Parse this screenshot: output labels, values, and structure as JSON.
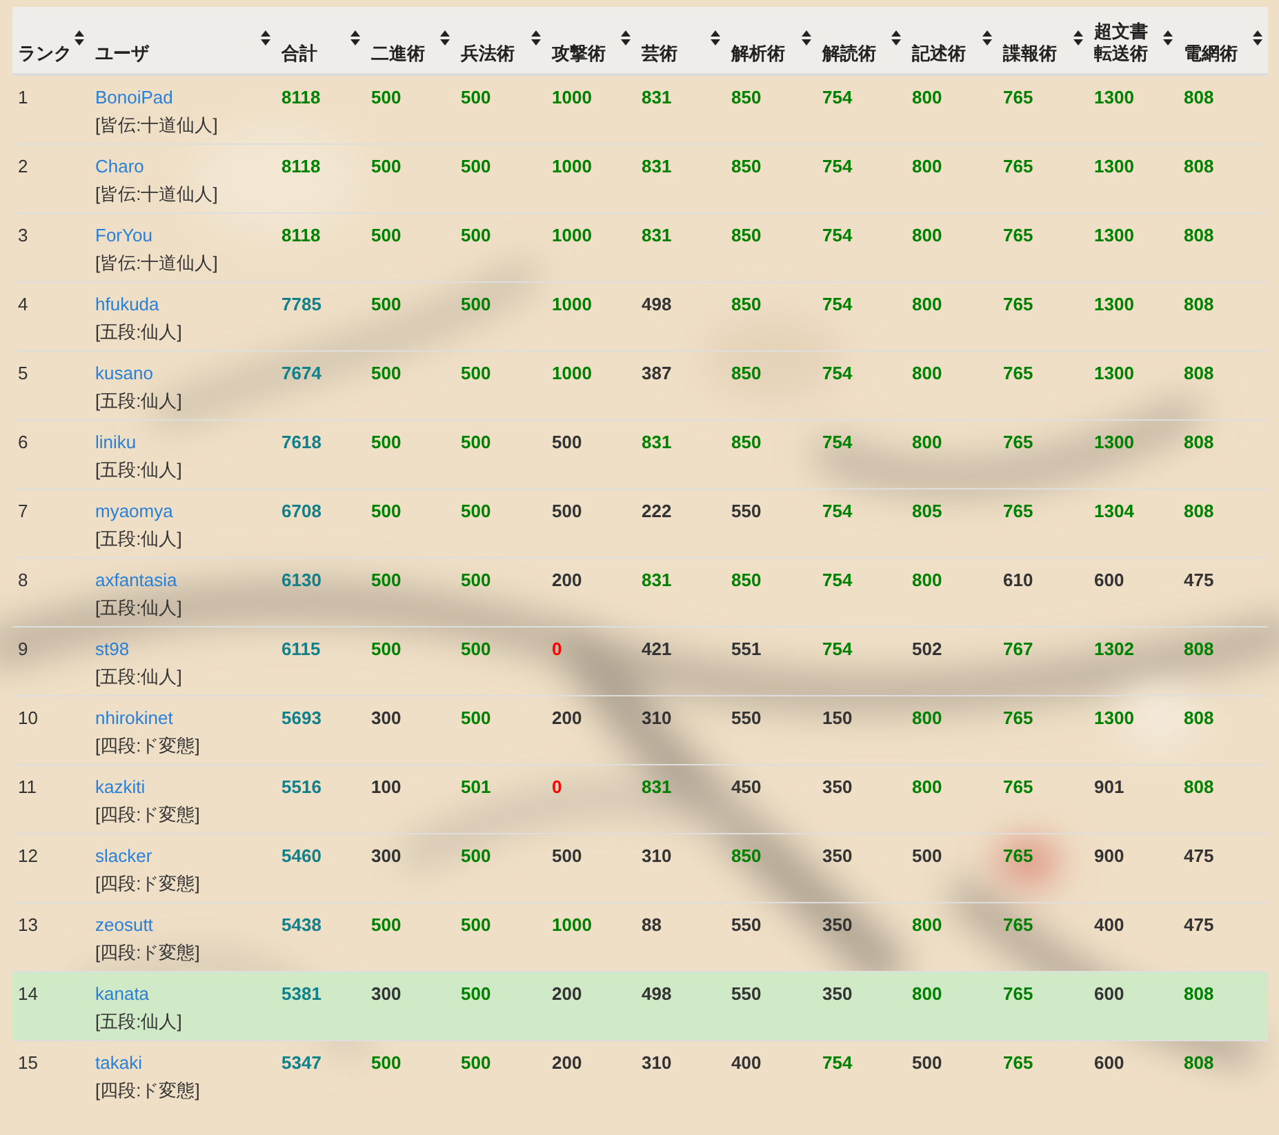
{
  "columns": [
    {
      "label": "ランク"
    },
    {
      "label": "ユーザ"
    },
    {
      "label": "合計"
    },
    {
      "label": "二進術"
    },
    {
      "label": "兵法術"
    },
    {
      "label": "攻撃術"
    },
    {
      "label": "芸術"
    },
    {
      "label": "解析術"
    },
    {
      "label": "解読術"
    },
    {
      "label": "記述術"
    },
    {
      "label": "諜報術"
    },
    {
      "label": "超文書転送術"
    },
    {
      "label": "電網術"
    }
  ],
  "rows": [
    {
      "rank": "1",
      "user": "BonoiPad",
      "title": "[皆伝:十道仙人]",
      "highlighted": false,
      "total": {
        "v": "8118",
        "color": "#008000"
      },
      "scores": [
        {
          "v": "500",
          "color": "#008000"
        },
        {
          "v": "500",
          "color": "#008000"
        },
        {
          "v": "1000",
          "color": "#008000"
        },
        {
          "v": "831",
          "color": "#008000"
        },
        {
          "v": "850",
          "color": "#008000"
        },
        {
          "v": "754",
          "color": "#008000"
        },
        {
          "v": "800",
          "color": "#008000"
        },
        {
          "v": "765",
          "color": "#008000"
        },
        {
          "v": "1300",
          "color": "#008000"
        },
        {
          "v": "808",
          "color": "#008000"
        }
      ]
    },
    {
      "rank": "2",
      "user": "Charo",
      "title": "[皆伝:十道仙人]",
      "highlighted": false,
      "total": {
        "v": "8118",
        "color": "#008000"
      },
      "scores": [
        {
          "v": "500",
          "color": "#008000"
        },
        {
          "v": "500",
          "color": "#008000"
        },
        {
          "v": "1000",
          "color": "#008000"
        },
        {
          "v": "831",
          "color": "#008000"
        },
        {
          "v": "850",
          "color": "#008000"
        },
        {
          "v": "754",
          "color": "#008000"
        },
        {
          "v": "800",
          "color": "#008000"
        },
        {
          "v": "765",
          "color": "#008000"
        },
        {
          "v": "1300",
          "color": "#008000"
        },
        {
          "v": "808",
          "color": "#008000"
        }
      ]
    },
    {
      "rank": "3",
      "user": "ForYou",
      "title": "[皆伝:十道仙人]",
      "highlighted": false,
      "total": {
        "v": "8118",
        "color": "#008000"
      },
      "scores": [
        {
          "v": "500",
          "color": "#008000"
        },
        {
          "v": "500",
          "color": "#008000"
        },
        {
          "v": "1000",
          "color": "#008000"
        },
        {
          "v": "831",
          "color": "#008000"
        },
        {
          "v": "850",
          "color": "#008000"
        },
        {
          "v": "754",
          "color": "#008000"
        },
        {
          "v": "800",
          "color": "#008000"
        },
        {
          "v": "765",
          "color": "#008000"
        },
        {
          "v": "1300",
          "color": "#008000"
        },
        {
          "v": "808",
          "color": "#008000"
        }
      ]
    },
    {
      "rank": "4",
      "user": "hfukuda",
      "title": "[五段:仙人]",
      "highlighted": false,
      "total": {
        "v": "7785",
        "color": "#11808a"
      },
      "scores": [
        {
          "v": "500",
          "color": "#008000"
        },
        {
          "v": "500",
          "color": "#008000"
        },
        {
          "v": "1000",
          "color": "#008000"
        },
        {
          "v": "498",
          "color": "#333333"
        },
        {
          "v": "850",
          "color": "#008000"
        },
        {
          "v": "754",
          "color": "#008000"
        },
        {
          "v": "800",
          "color": "#008000"
        },
        {
          "v": "765",
          "color": "#008000"
        },
        {
          "v": "1300",
          "color": "#008000"
        },
        {
          "v": "808",
          "color": "#008000"
        }
      ]
    },
    {
      "rank": "5",
      "user": "kusano",
      "title": "[五段:仙人]",
      "highlighted": false,
      "total": {
        "v": "7674",
        "color": "#11808a"
      },
      "scores": [
        {
          "v": "500",
          "color": "#008000"
        },
        {
          "v": "500",
          "color": "#008000"
        },
        {
          "v": "1000",
          "color": "#008000"
        },
        {
          "v": "387",
          "color": "#333333"
        },
        {
          "v": "850",
          "color": "#008000"
        },
        {
          "v": "754",
          "color": "#008000"
        },
        {
          "v": "800",
          "color": "#008000"
        },
        {
          "v": "765",
          "color": "#008000"
        },
        {
          "v": "1300",
          "color": "#008000"
        },
        {
          "v": "808",
          "color": "#008000"
        }
      ]
    },
    {
      "rank": "6",
      "user": "liniku",
      "title": "[五段:仙人]",
      "highlighted": false,
      "total": {
        "v": "7618",
        "color": "#11808a"
      },
      "scores": [
        {
          "v": "500",
          "color": "#008000"
        },
        {
          "v": "500",
          "color": "#008000"
        },
        {
          "v": "500",
          "color": "#333333"
        },
        {
          "v": "831",
          "color": "#008000"
        },
        {
          "v": "850",
          "color": "#008000"
        },
        {
          "v": "754",
          "color": "#008000"
        },
        {
          "v": "800",
          "color": "#008000"
        },
        {
          "v": "765",
          "color": "#008000"
        },
        {
          "v": "1300",
          "color": "#008000"
        },
        {
          "v": "808",
          "color": "#008000"
        }
      ]
    },
    {
      "rank": "7",
      "user": "myaomya",
      "title": "[五段:仙人]",
      "highlighted": false,
      "total": {
        "v": "6708",
        "color": "#11808a"
      },
      "scores": [
        {
          "v": "500",
          "color": "#008000"
        },
        {
          "v": "500",
          "color": "#008000"
        },
        {
          "v": "500",
          "color": "#333333"
        },
        {
          "v": "222",
          "color": "#333333"
        },
        {
          "v": "550",
          "color": "#333333"
        },
        {
          "v": "754",
          "color": "#008000"
        },
        {
          "v": "805",
          "color": "#008000"
        },
        {
          "v": "765",
          "color": "#008000"
        },
        {
          "v": "1304",
          "color": "#008000"
        },
        {
          "v": "808",
          "color": "#008000"
        }
      ]
    },
    {
      "rank": "8",
      "user": "axfantasia",
      "title": "[五段:仙人]",
      "highlighted": false,
      "total": {
        "v": "6130",
        "color": "#11808a"
      },
      "scores": [
        {
          "v": "500",
          "color": "#008000"
        },
        {
          "v": "500",
          "color": "#008000"
        },
        {
          "v": "200",
          "color": "#333333"
        },
        {
          "v": "831",
          "color": "#008000"
        },
        {
          "v": "850",
          "color": "#008000"
        },
        {
          "v": "754",
          "color": "#008000"
        },
        {
          "v": "800",
          "color": "#008000"
        },
        {
          "v": "610",
          "color": "#333333"
        },
        {
          "v": "600",
          "color": "#333333"
        },
        {
          "v": "475",
          "color": "#333333"
        }
      ]
    },
    {
      "rank": "9",
      "user": "st98",
      "title": "[五段:仙人]",
      "highlighted": false,
      "total": {
        "v": "6115",
        "color": "#11808a"
      },
      "scores": [
        {
          "v": "500",
          "color": "#008000"
        },
        {
          "v": "500",
          "color": "#008000"
        },
        {
          "v": "0",
          "color": "#ff0000"
        },
        {
          "v": "421",
          "color": "#333333"
        },
        {
          "v": "551",
          "color": "#333333"
        },
        {
          "v": "754",
          "color": "#008000"
        },
        {
          "v": "502",
          "color": "#333333"
        },
        {
          "v": "767",
          "color": "#008000"
        },
        {
          "v": "1302",
          "color": "#008000"
        },
        {
          "v": "808",
          "color": "#008000"
        }
      ]
    },
    {
      "rank": "10",
      "user": "nhirokinet",
      "title": "[四段:ド変態]",
      "highlighted": false,
      "total": {
        "v": "5693",
        "color": "#11808a"
      },
      "scores": [
        {
          "v": "300",
          "color": "#333333"
        },
        {
          "v": "500",
          "color": "#008000"
        },
        {
          "v": "200",
          "color": "#333333"
        },
        {
          "v": "310",
          "color": "#333333"
        },
        {
          "v": "550",
          "color": "#333333"
        },
        {
          "v": "150",
          "color": "#333333"
        },
        {
          "v": "800",
          "color": "#008000"
        },
        {
          "v": "765",
          "color": "#008000"
        },
        {
          "v": "1300",
          "color": "#008000"
        },
        {
          "v": "808",
          "color": "#008000"
        }
      ]
    },
    {
      "rank": "11",
      "user": "kazkiti",
      "title": "[四段:ド変態]",
      "highlighted": false,
      "total": {
        "v": "5516",
        "color": "#11808a"
      },
      "scores": [
        {
          "v": "100",
          "color": "#333333"
        },
        {
          "v": "501",
          "color": "#008000"
        },
        {
          "v": "0",
          "color": "#ff0000"
        },
        {
          "v": "831",
          "color": "#008000"
        },
        {
          "v": "450",
          "color": "#333333"
        },
        {
          "v": "350",
          "color": "#333333"
        },
        {
          "v": "800",
          "color": "#008000"
        },
        {
          "v": "765",
          "color": "#008000"
        },
        {
          "v": "901",
          "color": "#333333"
        },
        {
          "v": "808",
          "color": "#008000"
        }
      ]
    },
    {
      "rank": "12",
      "user": "slacker",
      "title": "[四段:ド変態]",
      "highlighted": false,
      "total": {
        "v": "5460",
        "color": "#11808a"
      },
      "scores": [
        {
          "v": "300",
          "color": "#333333"
        },
        {
          "v": "500",
          "color": "#008000"
        },
        {
          "v": "500",
          "color": "#333333"
        },
        {
          "v": "310",
          "color": "#333333"
        },
        {
          "v": "850",
          "color": "#008000"
        },
        {
          "v": "350",
          "color": "#333333"
        },
        {
          "v": "500",
          "color": "#333333"
        },
        {
          "v": "765",
          "color": "#008000"
        },
        {
          "v": "900",
          "color": "#333333"
        },
        {
          "v": "475",
          "color": "#333333"
        }
      ]
    },
    {
      "rank": "13",
      "user": "zeosutt",
      "title": "[四段:ド変態]",
      "highlighted": false,
      "total": {
        "v": "5438",
        "color": "#11808a"
      },
      "scores": [
        {
          "v": "500",
          "color": "#008000"
        },
        {
          "v": "500",
          "color": "#008000"
        },
        {
          "v": "1000",
          "color": "#008000"
        },
        {
          "v": "88",
          "color": "#333333"
        },
        {
          "v": "550",
          "color": "#333333"
        },
        {
          "v": "350",
          "color": "#333333"
        },
        {
          "v": "800",
          "color": "#008000"
        },
        {
          "v": "765",
          "color": "#008000"
        },
        {
          "v": "400",
          "color": "#333333"
        },
        {
          "v": "475",
          "color": "#333333"
        }
      ]
    },
    {
      "rank": "14",
      "user": "kanata",
      "title": "[五段:仙人]",
      "highlighted": true,
      "total": {
        "v": "5381",
        "color": "#11808a"
      },
      "scores": [
        {
          "v": "300",
          "color": "#333333"
        },
        {
          "v": "500",
          "color": "#008000"
        },
        {
          "v": "200",
          "color": "#333333"
        },
        {
          "v": "498",
          "color": "#333333"
        },
        {
          "v": "550",
          "color": "#333333"
        },
        {
          "v": "350",
          "color": "#333333"
        },
        {
          "v": "800",
          "color": "#008000"
        },
        {
          "v": "765",
          "color": "#008000"
        },
        {
          "v": "600",
          "color": "#333333"
        },
        {
          "v": "808",
          "color": "#008000"
        }
      ]
    },
    {
      "rank": "15",
      "user": "takaki",
      "title": "[四段:ド変態]",
      "highlighted": false,
      "total": {
        "v": "5347",
        "color": "#11808a"
      },
      "scores": [
        {
          "v": "500",
          "color": "#008000"
        },
        {
          "v": "500",
          "color": "#008000"
        },
        {
          "v": "200",
          "color": "#333333"
        },
        {
          "v": "310",
          "color": "#333333"
        },
        {
          "v": "400",
          "color": "#333333"
        },
        {
          "v": "754",
          "color": "#008000"
        },
        {
          "v": "500",
          "color": "#333333"
        },
        {
          "v": "765",
          "color": "#008000"
        },
        {
          "v": "600",
          "color": "#333333"
        },
        {
          "v": "808",
          "color": "#008000"
        }
      ]
    }
  ]
}
